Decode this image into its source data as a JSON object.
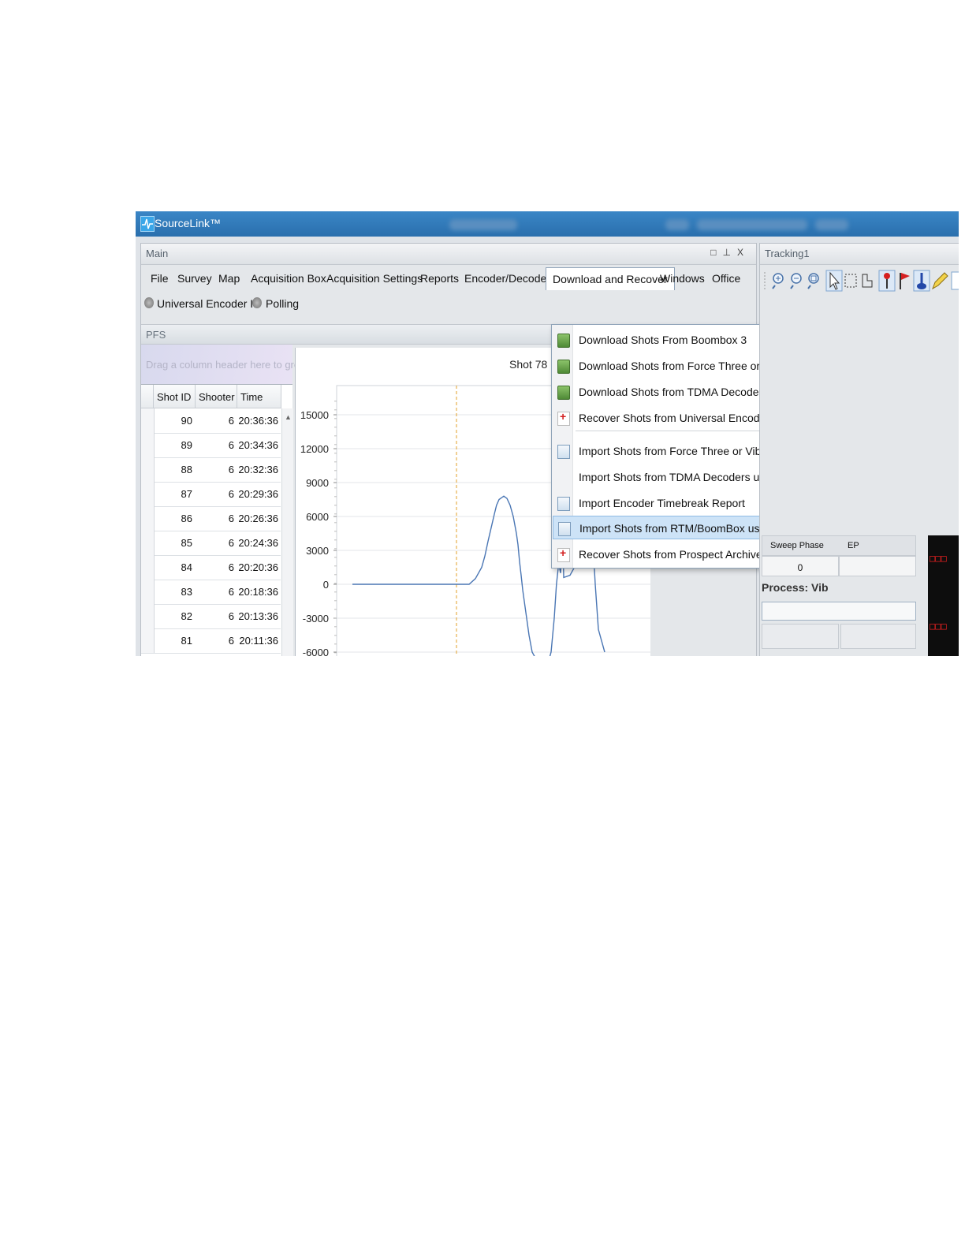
{
  "app": {
    "title": "SourceLink™"
  },
  "main_panel": {
    "title": "Main",
    "header_buttons": [
      "□",
      "⊥",
      "X"
    ],
    "menu": [
      "File",
      "Survey",
      "Map",
      "Acquisition Box",
      "Acquisition Settings",
      "Reports",
      "Encoder/Decoders",
      "Download and Recover",
      "Windows",
      "Office"
    ],
    "active_menu": "Download and Recover",
    "status": [
      {
        "label": "Universal Encoder II"
      },
      {
        "label": "Polling"
      }
    ],
    "pfs_title": "PFS",
    "group_hint": "Drag a column header here to group",
    "grid": {
      "columns": [
        "Shot ID",
        "Shooter",
        "Time"
      ],
      "rows": [
        [
          "90",
          "6",
          "20:36:36"
        ],
        [
          "89",
          "6",
          "20:34:36"
        ],
        [
          "88",
          "6",
          "20:32:36"
        ],
        [
          "87",
          "6",
          "20:29:36"
        ],
        [
          "86",
          "6",
          "20:26:36"
        ],
        [
          "85",
          "6",
          "20:24:36"
        ],
        [
          "84",
          "6",
          "20:20:36"
        ],
        [
          "83",
          "6",
          "20:18:36"
        ],
        [
          "82",
          "6",
          "20:13:36"
        ],
        [
          "81",
          "6",
          "20:11:36"
        ]
      ]
    }
  },
  "dropdown": {
    "items": [
      {
        "label": "Download Shots From Boombox 3",
        "icon": "green-download-icon"
      },
      {
        "label": "Download Shots from Force Three or VibPro HD",
        "icon": "green-download-icon"
      },
      {
        "label": "Download Shots from TDMA Decoder Unit",
        "icon": "green-download-icon"
      },
      {
        "label": "Recover Shots from Universal Encoder II",
        "icon": "red-recover-icon"
      },
      {
        "label": "Import Shots from Force Three or VibPro HD Decoders using PSS or Download Report Files",
        "icon": "document-import-icon"
      },
      {
        "label": "Import Shots from TDMA Decoders using PSS or Download Report Files",
        "icon": ""
      },
      {
        "label": "Import Encoder Timebreak Report",
        "icon": "document-import-icon"
      },
      {
        "label": "Import Shots from RTM/BoomBox using PFS or HandHeld CSV Files",
        "icon": "document-import-icon",
        "highlighted": true
      },
      {
        "label": "Recover Shots from Prospect Archive",
        "icon": "red-recover-icon"
      }
    ]
  },
  "tracking_panel": {
    "title": "Tracking1",
    "sweep_phase_label": "Sweep Phase",
    "ep_label": "EP",
    "sweep_phase_value": "0",
    "process_label": "Process: Vib",
    "display_glyphs": [
      "□□□",
      "□□□"
    ]
  },
  "chart_data": {
    "type": "line",
    "title": "Shot 78",
    "y_ticks": [
      15000,
      12000,
      9000,
      6000,
      3000,
      0,
      -3000,
      -6000
    ],
    "ylim": [
      -6000,
      16200
    ],
    "xlim": [
      0,
      100
    ],
    "marker_x": 38,
    "series": [
      {
        "x": [
          5,
          40,
          42,
          44,
          46,
          47,
          48,
          49,
          50,
          50.7,
          51.5,
          53,
          54,
          55,
          56,
          57,
          57.5,
          58,
          58.5,
          59,
          60,
          61,
          62,
          64,
          66,
          67,
          68,
          69,
          69.7,
          70.4,
          71,
          71.4,
          71.8,
          72,
          74,
          76,
          77,
          78,
          79,
          79.6,
          80.3,
          81,
          82,
          83,
          85
        ],
        "y": [
          0,
          0,
          0,
          500,
          1500,
          2500,
          3800,
          5000,
          6200,
          7000,
          7500,
          7800,
          7600,
          7000,
          6000,
          4500,
          3500,
          2000,
          800,
          -500,
          -2500,
          -4500,
          -6000,
          -7000,
          -7500,
          -7000,
          -6000,
          -3000,
          0,
          1800,
          1000,
          2500,
          3200,
          600,
          800,
          1800,
          4000,
          7000,
          9000,
          10000,
          8000,
          5000,
          0,
          -4000,
          -6000
        ]
      }
    ],
    "grid": true
  }
}
